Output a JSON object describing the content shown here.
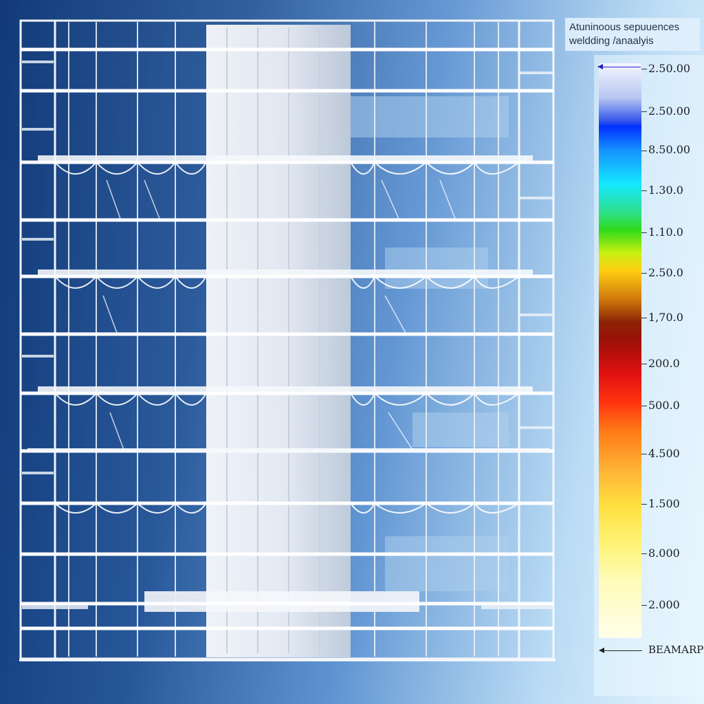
{
  "legend": {
    "title_line1": "Atuninoous sepuuences",
    "title_line2": "weldding /anaalyis",
    "labels": [
      "2.50.00",
      "2.50.00",
      "8.50.00",
      "1.30.0",
      "1.10.0",
      "2.50.0",
      "1,70.0",
      "200.0",
      "500.0",
      "4.500",
      "1.500",
      "8.000",
      "2.000"
    ],
    "footer_label": "BEAMARP"
  },
  "colors": {
    "background_dark": "#123a78",
    "background_light": "#dff2fd",
    "structure": "#ffffff",
    "pointer_top": "#2424c8",
    "pointer_bottom": "#222222"
  },
  "icons": [
    "top-pointer-arrow-icon",
    "beam-pointer-arrow-icon"
  ]
}
